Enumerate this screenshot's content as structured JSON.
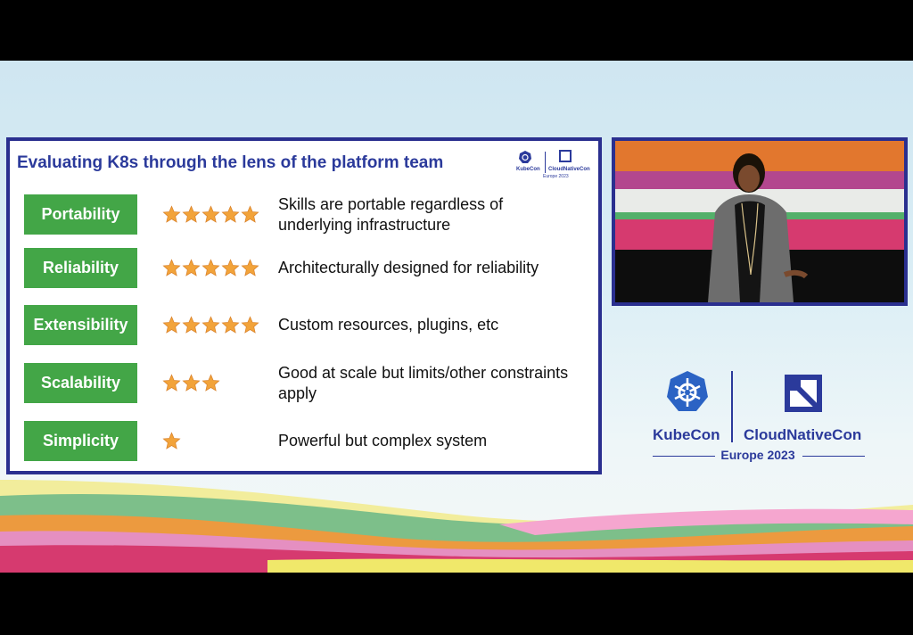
{
  "slide": {
    "title": "Evaluating K8s through the lens of the platform team",
    "mini_logo": {
      "kubecon": "KubeCon",
      "cncf": "CloudNativeCon",
      "event": "Europe 2023"
    },
    "rows": [
      {
        "label": "Portability",
        "stars": 5,
        "description": "Skills are portable regardless of underlying infrastructure"
      },
      {
        "label": "Reliability",
        "stars": 5,
        "description": "Architecturally designed for reliability"
      },
      {
        "label": "Extensibility",
        "stars": 5,
        "description": "Custom resources, plugins, etc"
      },
      {
        "label": "Scalability",
        "stars": 3,
        "description": "Good at scale but limits/other constraints apply"
      },
      {
        "label": "Simplicity",
        "stars": 1,
        "description": "Powerful but complex system"
      }
    ]
  },
  "branding": {
    "kubecon": "KubeCon",
    "cncf": "CloudNativeCon",
    "event": "Europe 2023"
  },
  "colors": {
    "accent_blue": "#2b3a9b",
    "tag_green": "#43a647",
    "star_orange": "#f2a33a"
  },
  "icons": {
    "rating": "star-icon",
    "kubecon": "kubernetes-helm-icon",
    "cncf": "cncf-square-icon"
  }
}
